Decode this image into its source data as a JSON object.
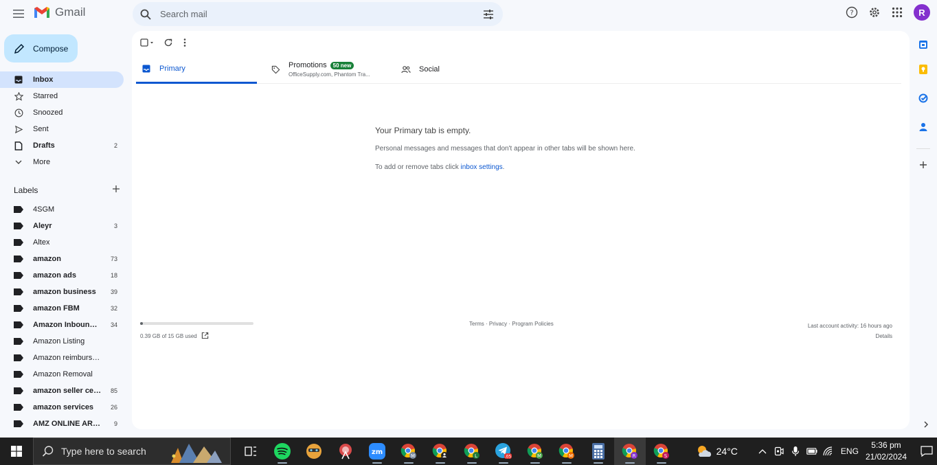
{
  "header": {
    "app_name": "Gmail",
    "search_placeholder": "Search mail",
    "avatar_initial": "R"
  },
  "compose_label": "Compose",
  "nav": [
    {
      "icon": "inbox-icon",
      "label": "Inbox",
      "count": "",
      "active": true
    },
    {
      "icon": "star-icon",
      "label": "Starred",
      "count": ""
    },
    {
      "icon": "clock-icon",
      "label": "Snoozed",
      "count": ""
    },
    {
      "icon": "send-icon",
      "label": "Sent",
      "count": ""
    },
    {
      "icon": "draft-icon",
      "label": "Drafts",
      "count": "2"
    },
    {
      "icon": "chevron-down-icon",
      "label": "More",
      "count": ""
    }
  ],
  "labels_title": "Labels",
  "labels": [
    {
      "label": "4SGM",
      "count": "",
      "bold": false
    },
    {
      "label": "Aleyr",
      "count": "3",
      "bold": true
    },
    {
      "label": "Altex",
      "count": "",
      "bold": false
    },
    {
      "label": "amazon",
      "count": "73",
      "bold": true
    },
    {
      "label": "amazon ads",
      "count": "18",
      "bold": true
    },
    {
      "label": "amazon business",
      "count": "39",
      "bold": true
    },
    {
      "label": "amazon FBM",
      "count": "32",
      "bold": true
    },
    {
      "label": "Amazon Inbound ...",
      "count": "34",
      "bold": true
    },
    {
      "label": "Amazon Listing",
      "count": "",
      "bold": false
    },
    {
      "label": "Amazon reimbursement",
      "count": "",
      "bold": false
    },
    {
      "label": "Amazon Removal",
      "count": "",
      "bold": false
    },
    {
      "label": "amazon seller cen...",
      "count": "85",
      "bold": true
    },
    {
      "label": "amazon services",
      "count": "26",
      "bold": true
    },
    {
      "label": "AMZ ONLINE ARBI...",
      "count": "9",
      "bold": true
    }
  ],
  "tabs": {
    "primary": "Primary",
    "promotions": "Promotions",
    "promotions_badge": "50 new",
    "promotions_sub": "OfficeSupply.com, Phantom Tra...",
    "social": "Social"
  },
  "empty_state": {
    "title": "Your Primary tab is empty.",
    "subtitle": "Personal messages and messages that don't appear in other tabs will be shown here.",
    "add_prefix": "To add or remove tabs click ",
    "add_link": "inbox settings",
    "add_suffix": "."
  },
  "footer": {
    "storage": "0.39 GB of 15 GB used",
    "storage_fraction": 0.026,
    "links": "Terms · Privacy · Program Policies",
    "activity": "Last account activity: 16 hours ago",
    "details": "Details"
  },
  "taskbar": {
    "search_placeholder": "Type here to search",
    "weather": "24°C",
    "language": "ENG",
    "time": "5:36 pm",
    "date": "21/02/2024"
  },
  "colors": {
    "accent": "#0b57d0",
    "compose_bg": "#c2e7ff",
    "active_nav": "#d3e3fd",
    "badge": "#188038"
  }
}
